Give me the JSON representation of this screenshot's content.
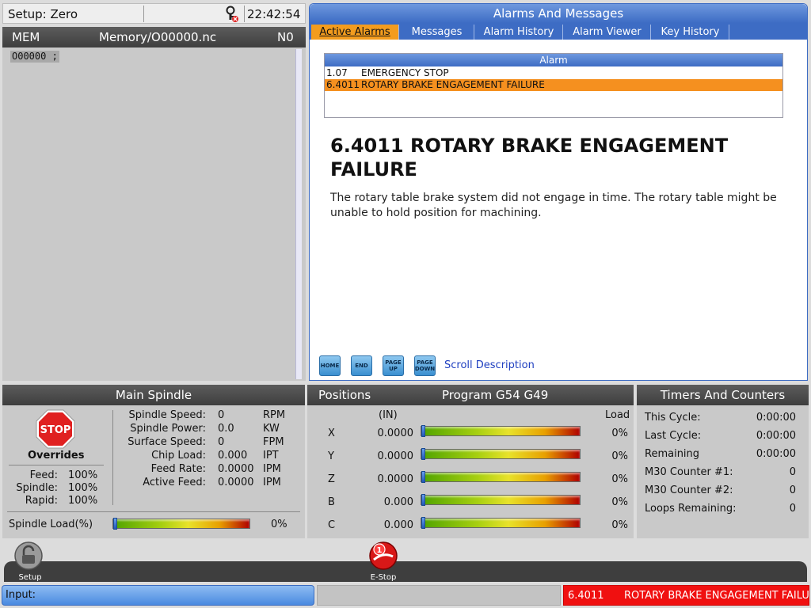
{
  "setup": {
    "mode_label": "Setup: Zero",
    "time": "22:42:54"
  },
  "program": {
    "mode": "MEM",
    "path": "Memory/O00000.nc",
    "n_number": "N0",
    "line": "O00000 ;"
  },
  "alarms": {
    "title": "Alarms And Messages",
    "tabs": [
      {
        "label": "Active Alarms"
      },
      {
        "label": "Messages"
      },
      {
        "label": "Alarm History"
      },
      {
        "label": "Alarm Viewer"
      },
      {
        "label": "Key History"
      }
    ],
    "list_header": "Alarm",
    "rows": [
      {
        "code": "1.07",
        "message": "EMERGENCY STOP"
      },
      {
        "code": "6.4011",
        "message": "ROTARY BRAKE ENGAGEMENT FAILURE"
      }
    ],
    "detail": {
      "title": "6.4011 ROTARY BRAKE ENGAGEMENT FAILURE",
      "text": "The rotary table brake system did not engage in time. The rotary table might be unable to hold position for machining."
    },
    "nav_buttons": [
      {
        "label": "HOME"
      },
      {
        "label": "END"
      },
      {
        "label": "PAGE UP"
      },
      {
        "label": "PAGE DOWN"
      }
    ],
    "scroll_label": "Scroll Description"
  },
  "spindle": {
    "title": "Main Spindle",
    "stop_label": "STOP",
    "overrides_label": "Overrides",
    "overrides": [
      {
        "label": "Feed:",
        "value": "100%"
      },
      {
        "label": "Spindle:",
        "value": "100%"
      },
      {
        "label": "Rapid:",
        "value": "100%"
      }
    ],
    "stats": [
      {
        "label": "Spindle Speed:",
        "value": "0",
        "unit": "RPM"
      },
      {
        "label": "Spindle Power:",
        "value": "0.0",
        "unit": "KW"
      },
      {
        "label": "Surface Speed:",
        "value": "0",
        "unit": "FPM"
      },
      {
        "label": "Chip Load:",
        "value": "0.000",
        "unit": "IPT"
      },
      {
        "label": "Feed Rate:",
        "value": "0.0000",
        "unit": "IPM"
      },
      {
        "label": "Active Feed:",
        "value": "0.0000",
        "unit": "IPM"
      }
    ],
    "load_label": "Spindle Load(%)",
    "load_value": "0%",
    "load_fraction": 0
  },
  "positions": {
    "title": "Positions",
    "program_label": "Program G54 G49",
    "units": "(IN)",
    "load_header": "Load",
    "axes": [
      {
        "axis": "X",
        "value": "0.0000",
        "load": "0%",
        "load_fraction": 0
      },
      {
        "axis": "Y",
        "value": "0.0000",
        "load": "0%",
        "load_fraction": 0
      },
      {
        "axis": "Z",
        "value": "0.0000",
        "load": "0%",
        "load_fraction": 0
      },
      {
        "axis": "B",
        "value": "0.000",
        "load": "0%",
        "load_fraction": 0
      },
      {
        "axis": "C",
        "value": "0.000",
        "load": "0%",
        "load_fraction": 0
      }
    ]
  },
  "timers": {
    "title": "Timers And Counters",
    "rows": [
      {
        "label": "This Cycle:",
        "value": "0:00:00"
      },
      {
        "label": "Last Cycle:",
        "value": "0:00:00"
      },
      {
        "label": "Remaining",
        "value": "0:00:00"
      },
      {
        "label": "M30 Counter #1:",
        "value": "0"
      },
      {
        "label": "M30 Counter #2:",
        "value": "0"
      },
      {
        "label": "Loops Remaining:",
        "value": "0"
      }
    ]
  },
  "dock": {
    "setup_label": "Setup",
    "estop_label": "E-Stop",
    "estop_badge": "1"
  },
  "status": {
    "input_label": "Input:",
    "alarm_code": "6.4011",
    "alarm_message": "ROTARY BRAKE ENGAGEMENT FAILUR"
  },
  "colors": {
    "accent_blue": "#3d6cc4",
    "active_tab": "#f39c1e",
    "alarm_red": "#f01010",
    "selected_row": "#f5901f"
  }
}
